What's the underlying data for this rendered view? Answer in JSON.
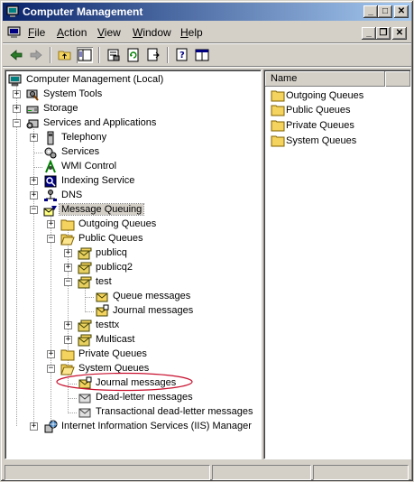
{
  "window": {
    "title": "Computer Management",
    "accent": "#0a246a",
    "controls": {
      "minimize": "_",
      "maximize": "□",
      "close": "✕"
    }
  },
  "menu": {
    "items": [
      {
        "label": "File",
        "u": "F",
        "rest": "ile"
      },
      {
        "label": "Action",
        "u": "A",
        "rest": "ction"
      },
      {
        "label": "View",
        "u": "V",
        "rest": "iew"
      },
      {
        "label": "Window",
        "u": "W",
        "rest": "indow"
      },
      {
        "label": "Help",
        "u": "H",
        "rest": "elp"
      }
    ],
    "mdi_controls": {
      "minimize": "_",
      "restore": "❐",
      "close": "✕"
    }
  },
  "toolbar": {
    "icons": [
      "back-icon",
      "forward-icon",
      "up-folder-icon",
      "show-hide-tree-icon",
      "properties-icon",
      "refresh-icon",
      "export-list-icon",
      "help-icon",
      "console-icon"
    ]
  },
  "tree": {
    "root": "Computer Management (Local)",
    "system_tools": "System Tools",
    "storage": "Storage",
    "services_apps": "Services and Applications",
    "telephony": "Telephony",
    "services": "Services",
    "wmi": "WMI Control",
    "indexing": "Indexing Service",
    "dns": "DNS",
    "msmq": "Message Queuing",
    "outgoing": "Outgoing Queues",
    "public": "Public Queues",
    "publicq": "publicq",
    "publicq2": "publicq2",
    "test": "test",
    "queue_messages": "Queue messages",
    "journal_messages_test": "Journal messages",
    "testtx": "testtx",
    "multicast": "Multicast",
    "private": "Private Queues",
    "system_queues": "System Queues",
    "journal_messages": "Journal messages",
    "dead_letter": "Dead-letter messages",
    "tx_dead_letter": "Transactional dead-letter messages",
    "iis": "Internet Information Services (IIS) Manager"
  },
  "list": {
    "column": "Name",
    "items": [
      "Outgoing Queues",
      "Public Queues",
      "Private Queues",
      "System Queues"
    ]
  },
  "annotation_color": "#c8102e"
}
